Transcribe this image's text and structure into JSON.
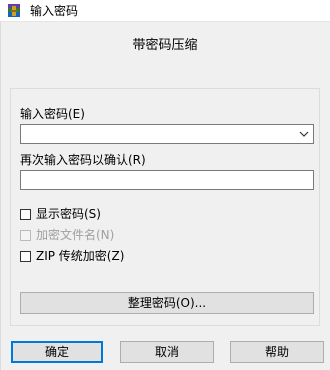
{
  "window": {
    "title": "输入密码",
    "app_icon": "winrar-icon"
  },
  "header": {
    "title": "带密码压缩"
  },
  "password": {
    "label": "输入密码(E)",
    "value": ""
  },
  "confirm": {
    "label": "再次输入密码以确认(R)",
    "value": ""
  },
  "options": [
    {
      "label": "显示密码(S)",
      "checked": false,
      "enabled": true
    },
    {
      "label": "加密文件名(N)",
      "checked": false,
      "enabled": false
    },
    {
      "label": "ZIP 传统加密(Z)",
      "checked": false,
      "enabled": true
    }
  ],
  "organize_button": {
    "label": "整理密码(O)..."
  },
  "buttons": {
    "ok": "确定",
    "cancel": "取消",
    "help": "帮助"
  }
}
